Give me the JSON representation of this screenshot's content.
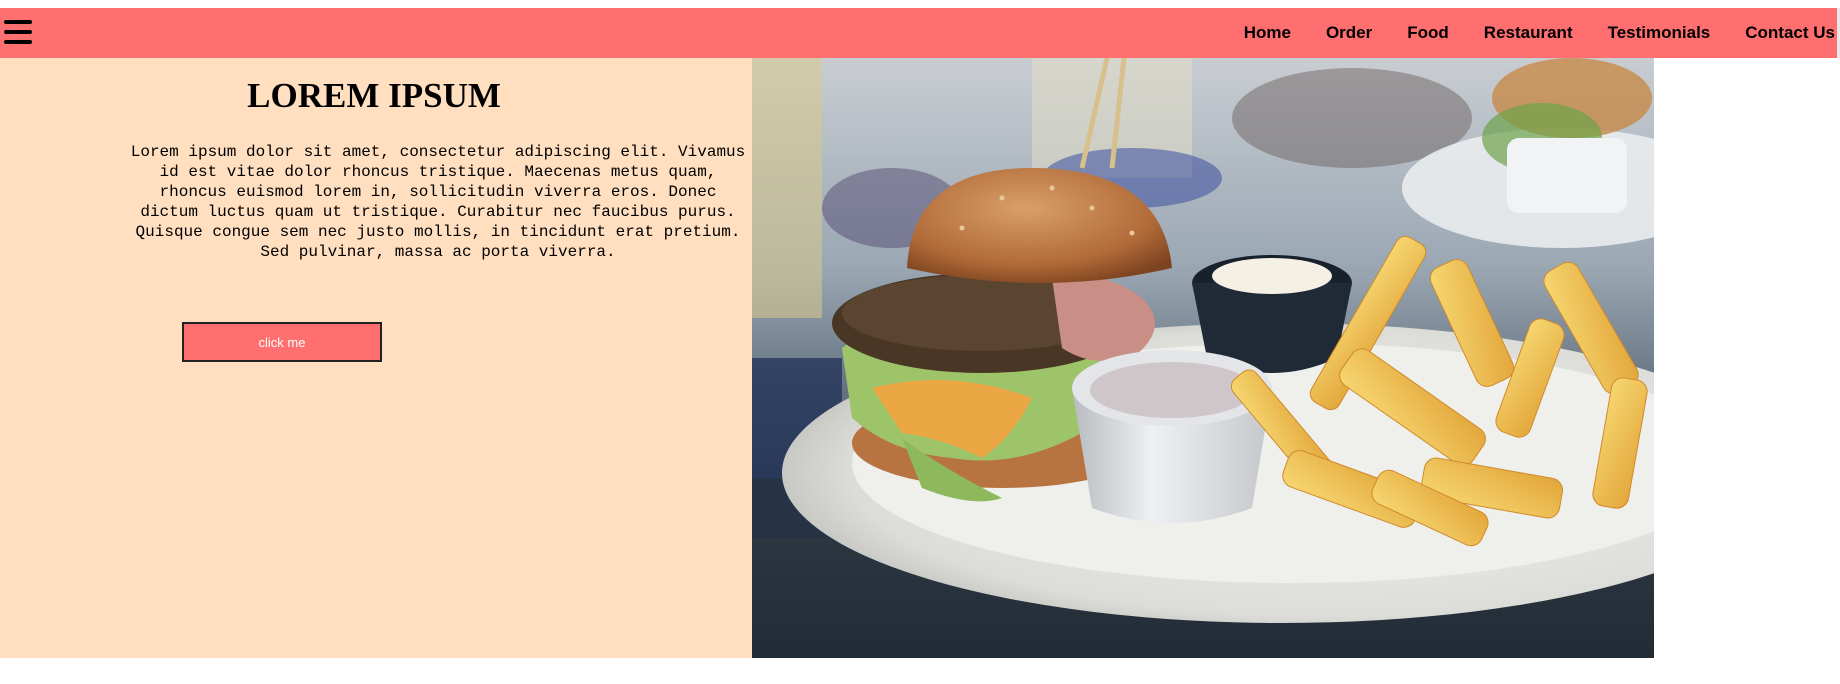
{
  "nav": {
    "menu_icon": "hamburger-menu-icon",
    "links": [
      "Home",
      "Order",
      "Food",
      "Restaurant",
      "Testimonials",
      "Contact Us"
    ]
  },
  "hero": {
    "title": "LOREM IPSUM",
    "text_lines": [
      "Lorem ipsum dolor sit amet, consectetur adipiscing elit. Vivamus",
      "id est vitae dolor rhoncus tristique. Maecenas metus quam,",
      "rhoncus euismod lorem in, sollicitudin viverra eros. Donec",
      "dictum luctus quam ut tristique. Curabitur nec faucibus purus.",
      "Quisque congue sem nec justo mollis, in tincidunt erat pretium.",
      "Sed pulvinar, massa ac porta viverra."
    ],
    "button_label": "click me",
    "image": "burger-and-fries-photo"
  },
  "colors": {
    "accent": "#FF6F6F",
    "hero_background": "#FFDFC0",
    "text": "#000000"
  }
}
